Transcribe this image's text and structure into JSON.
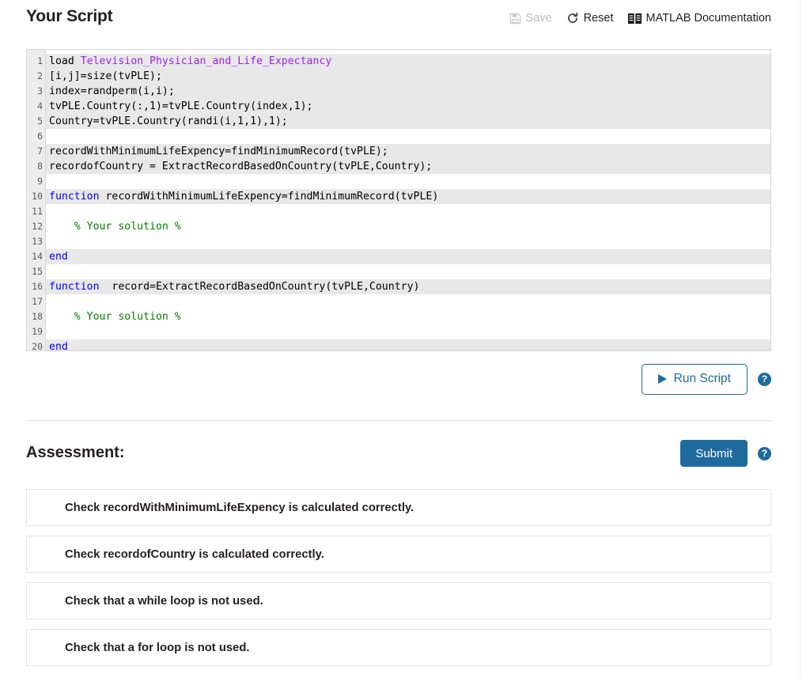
{
  "header": {
    "title": "Your Script",
    "actions": [
      {
        "label": "Save",
        "icon": "floppy-disk-icon",
        "disabled": true
      },
      {
        "label": "Reset",
        "icon": "refresh-icon",
        "disabled": false
      },
      {
        "label": "MATLAB Documentation",
        "icon": "book-icon",
        "disabled": false
      }
    ]
  },
  "editor": {
    "lines": [
      {
        "n": "1",
        "locked": true,
        "segments": [
          {
            "t": "load ",
            "c": "plain"
          },
          {
            "t": "Television_Physician_and_Life_Expectancy",
            "c": "tok-str"
          }
        ]
      },
      {
        "n": "2",
        "locked": true,
        "segments": [
          {
            "t": "[i,j]=size(tvPLE);",
            "c": "plain"
          }
        ]
      },
      {
        "n": "3",
        "locked": true,
        "segments": [
          {
            "t": "index=randperm(i,i);",
            "c": "plain"
          }
        ]
      },
      {
        "n": "4",
        "locked": true,
        "segments": [
          {
            "t": "tvPLE.Country(:,1)=tvPLE.Country(index,1);",
            "c": "plain"
          }
        ]
      },
      {
        "n": "5",
        "locked": true,
        "segments": [
          {
            "t": "Country=tvPLE.Country(randi(i,1,1),1);",
            "c": "plain"
          }
        ]
      },
      {
        "n": "6",
        "locked": false,
        "segments": [
          {
            "t": "",
            "c": "plain"
          }
        ]
      },
      {
        "n": "7",
        "locked": true,
        "segments": [
          {
            "t": "recordWithMinimumLifeExpency=findMinimumRecord(tvPLE);",
            "c": "plain"
          }
        ]
      },
      {
        "n": "8",
        "locked": true,
        "segments": [
          {
            "t": "recordofCountry = ExtractRecordBasedOnCountry(tvPLE,Country);",
            "c": "plain"
          }
        ]
      },
      {
        "n": "9",
        "locked": false,
        "segments": [
          {
            "t": "",
            "c": "plain"
          }
        ]
      },
      {
        "n": "10",
        "locked": true,
        "segments": [
          {
            "t": "function",
            "c": "tok-kw"
          },
          {
            "t": " recordWithMinimumLifeExpency=findMinimumRecord(tvPLE)",
            "c": "plain"
          }
        ]
      },
      {
        "n": "11",
        "locked": false,
        "segments": [
          {
            "t": "",
            "c": "plain"
          }
        ]
      },
      {
        "n": "12",
        "locked": false,
        "segments": [
          {
            "t": "    % Your solution %",
            "c": "tok-cmt"
          }
        ]
      },
      {
        "n": "13",
        "locked": false,
        "segments": [
          {
            "t": "",
            "c": "plain"
          }
        ]
      },
      {
        "n": "14",
        "locked": true,
        "segments": [
          {
            "t": "end",
            "c": "tok-kw"
          }
        ]
      },
      {
        "n": "15",
        "locked": false,
        "segments": [
          {
            "t": "",
            "c": "plain"
          }
        ]
      },
      {
        "n": "16",
        "locked": true,
        "segments": [
          {
            "t": "function",
            "c": "tok-kw"
          },
          {
            "t": "  record=ExtractRecordBasedOnCountry(tvPLE,Country)",
            "c": "plain"
          }
        ]
      },
      {
        "n": "17",
        "locked": false,
        "segments": [
          {
            "t": "",
            "c": "plain"
          }
        ]
      },
      {
        "n": "18",
        "locked": false,
        "segments": [
          {
            "t": "    % Your solution %",
            "c": "tok-cmt"
          }
        ]
      },
      {
        "n": "19",
        "locked": false,
        "segments": [
          {
            "t": "",
            "c": "plain"
          }
        ]
      },
      {
        "n": "20",
        "locked": true,
        "segments": [
          {
            "t": "end",
            "c": "tok-kw"
          }
        ]
      }
    ]
  },
  "run": {
    "button_label": "Run Script",
    "play_icon": "play-triangle-icon",
    "help_label": "?",
    "help_icon": "help-circle-icon"
  },
  "assessment": {
    "title": "Assessment:",
    "submit_label": "Submit",
    "help_label": "?",
    "help_icon": "help-circle-icon",
    "checks": [
      {
        "text": "Check recordWithMinimumLifeExpency is calculated correctly."
      },
      {
        "text": "Check recordofCountry is calculated correctly."
      },
      {
        "text": "Check that a while loop is not used."
      },
      {
        "text": "Check that a for loop is not used."
      }
    ]
  },
  "colors": {
    "accent_blue": "#1f6a9c",
    "keyword_blue": "#0000ff",
    "string_purple": "#a020f0",
    "comment_green": "#008000",
    "locked_line_bg": "#e8e8e8",
    "gutter_bg": "#ededed",
    "text_dark": "#231f20",
    "disabled_grey": "#bdbdbd"
  }
}
